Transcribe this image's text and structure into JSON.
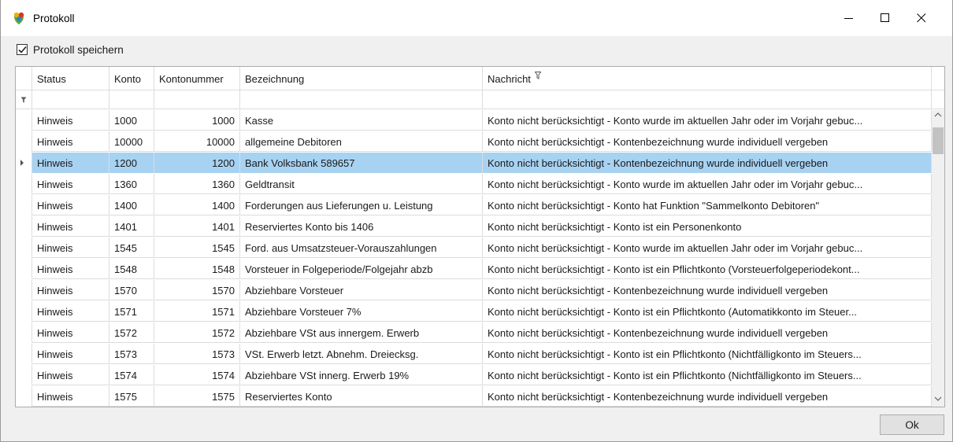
{
  "window": {
    "title": "Protokoll",
    "icon": "app-icon",
    "controls": {
      "minimize": "minimize-icon",
      "maximize": "maximize-icon",
      "close": "close-icon"
    }
  },
  "options": {
    "save_log_label": "Protokoll speichern",
    "save_log_checked": true
  },
  "grid": {
    "columns": [
      "Status",
      "Konto",
      "Kontonummer",
      "Bezeichnung",
      "Nachricht"
    ],
    "filter_icon": "filter-icon",
    "selected_row": 2,
    "rows": [
      {
        "status": "Hinweis",
        "konto": "1000",
        "kontonummer": "1000",
        "bezeichnung": "Kasse",
        "nachricht": "Konto nicht berücksichtigt - Konto wurde im aktuellen Jahr oder im Vorjahr gebuc..."
      },
      {
        "status": "Hinweis",
        "konto": "10000",
        "kontonummer": "10000",
        "bezeichnung": "allgemeine Debitoren",
        "nachricht": "Konto nicht berücksichtigt - Kontenbezeichnung wurde individuell vergeben"
      },
      {
        "status": "Hinweis",
        "konto": "1200",
        "kontonummer": "1200",
        "bezeichnung": "Bank Volksbank 589657",
        "nachricht": "Konto nicht berücksichtigt - Kontenbezeichnung wurde individuell vergeben"
      },
      {
        "status": "Hinweis",
        "konto": "1360",
        "kontonummer": "1360",
        "bezeichnung": "Geldtransit",
        "nachricht": "Konto nicht berücksichtigt - Konto wurde im aktuellen Jahr oder im Vorjahr gebuc..."
      },
      {
        "status": "Hinweis",
        "konto": "1400",
        "kontonummer": "1400",
        "bezeichnung": "Forderungen aus Lieferungen u. Leistung",
        "nachricht": "Konto nicht berücksichtigt - Konto hat Funktion \"Sammelkonto Debitoren\""
      },
      {
        "status": "Hinweis",
        "konto": "1401",
        "kontonummer": "1401",
        "bezeichnung": "Reserviertes Konto bis 1406",
        "nachricht": "Konto nicht berücksichtigt - Konto ist ein Personenkonto"
      },
      {
        "status": "Hinweis",
        "konto": "1545",
        "kontonummer": "1545",
        "bezeichnung": "Ford. aus Umsatzsteuer-Vorauszahlungen",
        "nachricht": "Konto nicht berücksichtigt - Konto wurde im aktuellen Jahr oder im Vorjahr gebuc..."
      },
      {
        "status": "Hinweis",
        "konto": "1548",
        "kontonummer": "1548",
        "bezeichnung": "Vorsteuer in Folgeperiode/Folgejahr abzb",
        "nachricht": "Konto nicht berücksichtigt - Konto ist ein Pflichtkonto (Vorsteuerfolgeperiodekont..."
      },
      {
        "status": "Hinweis",
        "konto": "1570",
        "kontonummer": "1570",
        "bezeichnung": "Abziehbare Vorsteuer",
        "nachricht": "Konto nicht berücksichtigt - Kontenbezeichnung wurde individuell vergeben"
      },
      {
        "status": "Hinweis",
        "konto": "1571",
        "kontonummer": "1571",
        "bezeichnung": "Abziehbare Vorsteuer 7%",
        "nachricht": "Konto nicht berücksichtigt - Konto ist ein Pflichtkonto (Automatikkonto im Steuer..."
      },
      {
        "status": "Hinweis",
        "konto": "1572",
        "kontonummer": "1572",
        "bezeichnung": "Abziehbare VSt aus innergem. Erwerb",
        "nachricht": "Konto nicht berücksichtigt - Kontenbezeichnung wurde individuell vergeben"
      },
      {
        "status": "Hinweis",
        "konto": "1573",
        "kontonummer": "1573",
        "bezeichnung": "VSt. Erwerb letzt. Abnehm. Dreiecksg.",
        "nachricht": "Konto nicht berücksichtigt - Konto ist ein Pflichtkonto (Nichtfälligkonto im Steuers..."
      },
      {
        "status": "Hinweis",
        "konto": "1574",
        "kontonummer": "1574",
        "bezeichnung": "Abziehbare VSt innerg. Erwerb 19%",
        "nachricht": "Konto nicht berücksichtigt - Konto ist ein Pflichtkonto (Nichtfälligkonto im Steuers..."
      },
      {
        "status": "Hinweis",
        "konto": "1575",
        "kontonummer": "1575",
        "bezeichnung": "Reserviertes Konto",
        "nachricht": "Konto nicht berücksichtigt - Kontenbezeichnung wurde individuell vergeben"
      }
    ]
  },
  "footer": {
    "ok_label": "Ok"
  },
  "colors": {
    "selection": "#cce8ff",
    "selection_cell": "#a8d2f2",
    "grid_line": "#dcdcdc"
  }
}
